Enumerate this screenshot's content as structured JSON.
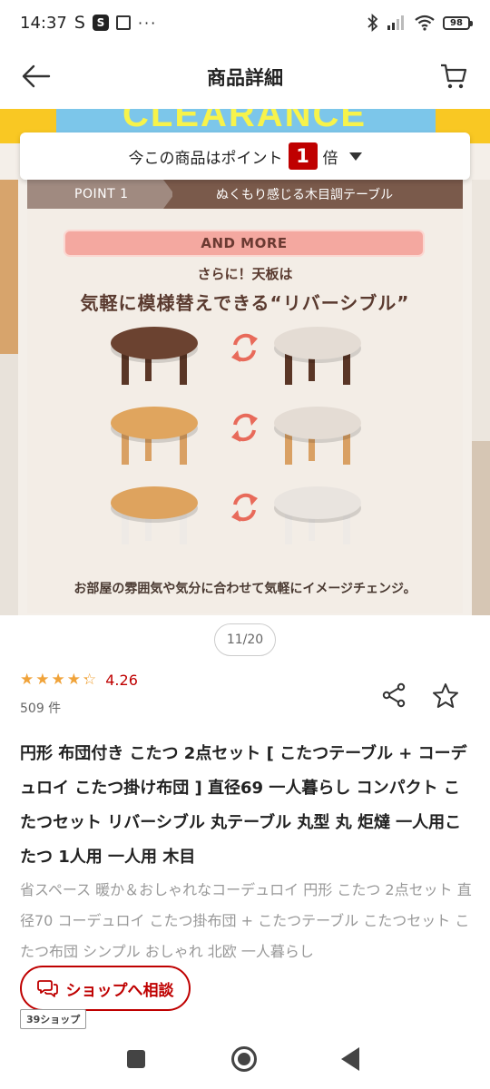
{
  "status_bar": {
    "time": "14:37",
    "s_label": "S",
    "badge_s": "S",
    "dots": "···",
    "battery": "98"
  },
  "header": {
    "title": "商品詳細"
  },
  "carousel": {
    "banner_text": "CLEARANCE",
    "points_prefix": "今この商品はポイント",
    "points_multiplier": "1",
    "points_suffix": "倍",
    "image": {
      "point_label": "POINT 1",
      "point_desc": "ぬくもり感じる木目調テーブル",
      "and_more": "AND MORE",
      "sub_heading": "さらに！天板は",
      "heading": "気軽に模様替えできる“リバーシブル”",
      "caption": "お部屋の雰囲気や気分に合わせて気軽にイメージチェンジ。",
      "table_pairs": [
        {
          "left_top": "#6b4230",
          "left_legs": "#5a3626",
          "right_top": "#e4dcd4",
          "right_legs": "#5a3626"
        },
        {
          "left_top": "#e0a55e",
          "left_legs": "#d9a063",
          "right_top": "#e4dcd4",
          "right_legs": "#d9a063"
        },
        {
          "left_top": "#dea35e",
          "left_legs": "#eeeae6",
          "right_top": "#e9e4df",
          "right_legs": "#eeeae6"
        }
      ]
    },
    "page_indicator": "11/20"
  },
  "rating": {
    "value": "4.26",
    "stars": 4.26,
    "review_count": "509 件"
  },
  "product": {
    "title": "円形 布団付き こたつ 2点セット [ こたつテーブル + コーデュロイ こたつ掛け布団 ] 直径69 一人暮らし コンパクト こたつセット リバーシブル 丸テーブル 丸型 丸 炬燵 一人用こたつ 1人用 一人用 木目",
    "description": "省スペース 暖か＆おしゃれなコーデュロイ 円形 こたつ 2点セット 直径70 コーデュロイ こたつ掛布団 + こたつテーブル こたつセット こたつ布団 シンプル おしゃれ 北欧 一人暮らし"
  },
  "consult": {
    "label": "ショップへ相談"
  },
  "shop_tag": "39ショップ",
  "colors": {
    "accent": "#bf0000",
    "star": "#f0a33a"
  }
}
